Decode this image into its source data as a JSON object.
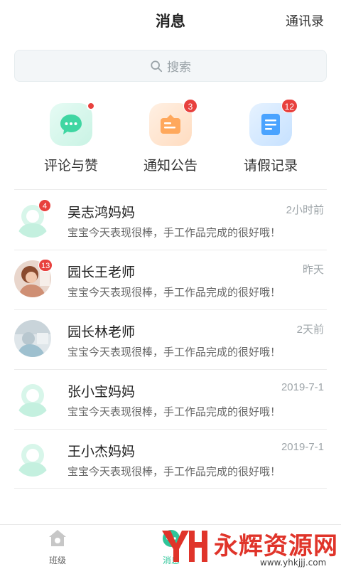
{
  "header": {
    "title": "消息",
    "contacts_label": "通讯录"
  },
  "search": {
    "placeholder": "搜索"
  },
  "quick_actions": [
    {
      "label": "评论与赞",
      "icon": "chat-bubble-icon",
      "badge": "",
      "dot": true,
      "color": "#3fd6a2"
    },
    {
      "label": "通知公告",
      "icon": "announcement-icon",
      "badge": "3",
      "dot": false,
      "color": "#ffa85c"
    },
    {
      "label": "请假记录",
      "icon": "document-icon",
      "badge": "12",
      "dot": false,
      "color": "#4aa3ff"
    }
  ],
  "conversations": [
    {
      "name": "吴志鸿妈妈",
      "time": "2小时前",
      "message": "宝宝今天表现很棒，手工作品完成的很好哦！",
      "badge": "4",
      "avatar": "default-avatar"
    },
    {
      "name": "园长王老师",
      "time": "昨天",
      "message": "宝宝今天表现很棒，手工作品完成的很好哦！",
      "badge": "13",
      "avatar": "photo-avatar"
    },
    {
      "name": "园长林老师",
      "time": "2天前",
      "message": "宝宝今天表现很棒，手工作品完成的很好哦！",
      "badge": "",
      "avatar": "photo-avatar"
    },
    {
      "name": "张小宝妈妈",
      "time": "2019-7-1",
      "message": "宝宝今天表现很棒，手工作品完成的很好哦！",
      "badge": "",
      "avatar": "default-avatar"
    },
    {
      "name": "王小杰妈妈",
      "time": "2019-7-1",
      "message": "宝宝今天表现很棒，手工作品完成的很好哦！",
      "badge": "",
      "avatar": "default-avatar"
    }
  ],
  "tabbar": {
    "tabs": [
      {
        "label": "班级",
        "icon": "home-icon",
        "active": false
      },
      {
        "label": "消息",
        "icon": "message-icon",
        "active": true
      }
    ]
  },
  "watermark": {
    "text": "永辉资源网",
    "url": "www.yhkjjj.com"
  },
  "colors": {
    "accent": "#2fc59a",
    "badge": "#e8413e",
    "divider": "#ececec"
  }
}
